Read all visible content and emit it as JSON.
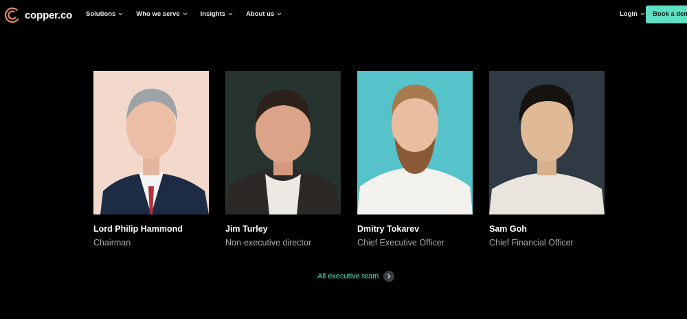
{
  "brand": {
    "name": "copper.co",
    "accent": "#5ee0c4"
  },
  "nav": {
    "items": [
      {
        "label": "Solutions"
      },
      {
        "label": "Who we serve"
      },
      {
        "label": "Insights"
      },
      {
        "label": "About us"
      }
    ],
    "login_label": "Login",
    "demo_label": "Book a demo"
  },
  "team": [
    {
      "name": "Lord Philip Hammond",
      "role": "Chairman",
      "photo_bg": "#f2d9cc"
    },
    {
      "name": "Jim Turley",
      "role": "Non-executive director",
      "photo_bg": "#26332f"
    },
    {
      "name": "Dmitry Tokarev",
      "role": "Chief Executive Officer",
      "photo_bg": "#55c3c9"
    },
    {
      "name": "Sam Goh",
      "role": "Chief Financial Officer",
      "photo_bg": "#2f3a44"
    }
  ],
  "all_team_label": "All executive team"
}
